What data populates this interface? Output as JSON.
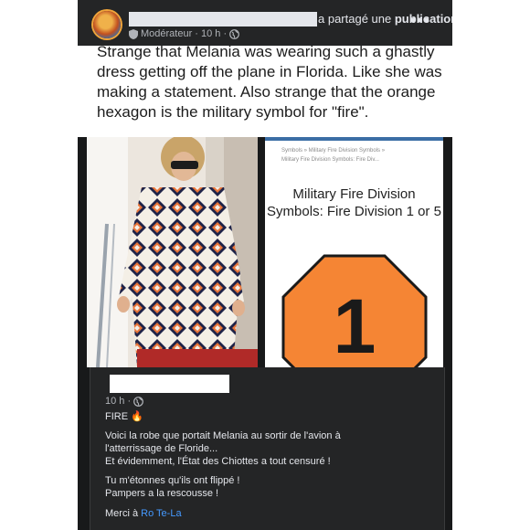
{
  "post": {
    "shared_prefix": "a partagé une ",
    "shared_bold": "publication",
    "shared_suffix": ".",
    "role": "Modérateur",
    "time": "· 10 h ·",
    "more": "•••"
  },
  "caption": {
    "text": "Strange that Melania was wearing such a ghastly dress getting off the plane in Florida. Like she was making a statement. Also strange that the orange hexagon is the military symbol for \"fire\"."
  },
  "right_image": {
    "crumb1": "Symbols  »  Military Fire Division Symbols  »",
    "crumb2": "Military Fire Division Symbols: Fire Div...",
    "title": "Military Fire Division Symbols: Fire Division 1 or 5",
    "octagon_number": "1",
    "octagon_color": "#f58534"
  },
  "comment": {
    "time": "10 h ·",
    "fire": "FIRE 🔥",
    "line1": "Voici la robe que portait Melania au sortir de l'avion à",
    "line2": "l'atterrissage de Floride...",
    "line3": "Et évidemment, l'État des Chiottes a tout censuré !",
    "line4": "Tu m'étonnes qu'ils ont flippé !",
    "line5": "Pampers a la rescousse !",
    "merci_prefix": "Merci à ",
    "merci_link": "Ro Te-La"
  },
  "colors": {
    "page_bg": "#18191a",
    "card_bg": "#242526",
    "text": "#e4e6eb",
    "muted": "#b0b3b8",
    "link": "#4599ff"
  }
}
